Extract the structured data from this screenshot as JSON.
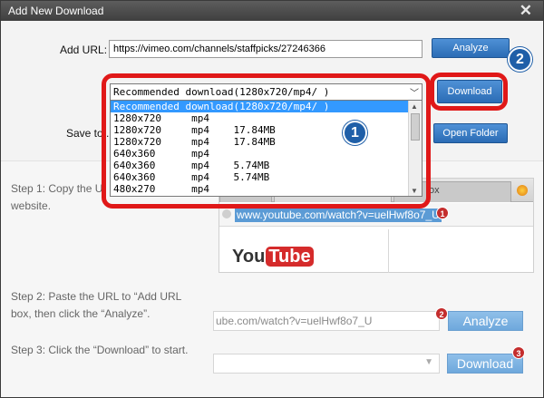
{
  "window": {
    "title": "Add New Download",
    "close_glyph": "✕"
  },
  "form": {
    "add_url_label": "Add URL:",
    "url_value": "https://vimeo.com/channels/staffpicks/27246366",
    "analyze_label": "Analyze",
    "download_label": "Download",
    "save_to_label": "Save to...",
    "open_folder_label": "Open Folder"
  },
  "format_select": {
    "selected": "Recommended download(1280x720/mp4/ )",
    "options": [
      "Recommended download(1280x720/mp4/ )",
      "1280x720     mp4",
      "1280x720     mp4    17.84MB",
      "1280x720     mp4    17.84MB",
      "640x360      mp4",
      "640x360      mp4    5.74MB",
      "640x360      mp4    5.74MB",
      "480x270      mp4"
    ]
  },
  "callouts": {
    "badge_1": "1",
    "badge_2": "2"
  },
  "steps": {
    "step1_line1": "Step 1: Copy the U",
    "step1_line2": "website.",
    "step2_line1": "Step 2: Paste the URL to “Add URL",
    "step2_line2": "box, then click the “Analyze”.",
    "step3": "Step 3: Click the “Download” to start."
  },
  "illustration": {
    "tab_label": "ox",
    "address_selected": "www.youtube.com/watch?v=uelHwf8o7_U",
    "youtube_logo_you": "You",
    "youtube_logo_tube": "Tube",
    "pasted_url": "ube.com/watch?v=uelHwf8o7_U",
    "analyze_label": "Analyze",
    "download_label": "Download",
    "num_1": "1",
    "num_2": "2",
    "num_3": "3"
  },
  "colors": {
    "accent_blue": "#2b6cb5",
    "highlight_red": "#e01818",
    "selection_blue": "#3399ff"
  }
}
